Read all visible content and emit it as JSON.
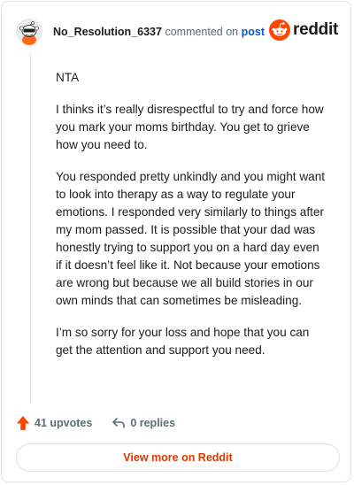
{
  "header": {
    "username": "No_Resolution_6337",
    "commented_text": "commented on",
    "post_link": "post",
    "brand_name": "reddit",
    "avatar_icon": "snoo-avatar-icon",
    "brand_icon": "reddit-logo-icon"
  },
  "comment": {
    "paragraphs": [
      "NTA",
      "I thinks it’s really disrespectful to try and force how you mark your moms birthday. You get to grieve how you need to.",
      "You responded pretty unkindly and you might want to look into therapy as a way to regulate your emotions. I responded very similarly to things after my mom passed. It is possible that your dad was honestly trying to support you on a hard day even if it doesn’t feel like it. Not because your emotions are wrong but because we all build stories in our own minds that can sometimes be misleading.",
      "I’m so sorry for your loss and hope that you can get the attention and support you need."
    ]
  },
  "actions": {
    "upvotes": "41 upvotes",
    "replies": "0 replies",
    "upvote_icon": "upvote-arrow-icon",
    "reply_icon": "reply-arrow-icon"
  },
  "footer": {
    "view_more": "View more on Reddit"
  },
  "colors": {
    "brand_orange": "#ff4500",
    "link_blue": "#0a58ca",
    "muted_text": "#576f76",
    "button_text": "#d93a00"
  }
}
